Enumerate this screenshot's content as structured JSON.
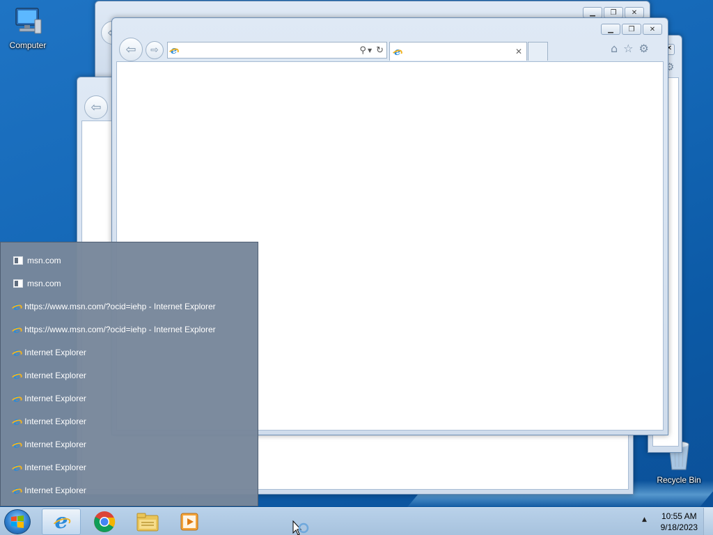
{
  "desktop": {
    "icons": [
      {
        "label": "Computer",
        "icon": "computer-icon"
      },
      {
        "label": "Recycle Bin",
        "icon": "recycle-bin-icon"
      }
    ]
  },
  "jumplist": {
    "items": [
      {
        "label": "msn.com",
        "icon": "page-icon"
      },
      {
        "label": "msn.com",
        "icon": "page-icon"
      },
      {
        "label": "https://www.msn.com/?ocid=iehp - Internet Explorer",
        "icon": "ie-icon"
      },
      {
        "label": "https://www.msn.com/?ocid=iehp - Internet Explorer",
        "icon": "ie-icon"
      },
      {
        "label": "Internet Explorer",
        "icon": "ie-icon"
      },
      {
        "label": "Internet Explorer",
        "icon": "ie-icon"
      },
      {
        "label": "Internet Explorer",
        "icon": "ie-icon"
      },
      {
        "label": "Internet Explorer",
        "icon": "ie-icon"
      },
      {
        "label": "Internet Explorer",
        "icon": "ie-icon"
      },
      {
        "label": "Internet Explorer",
        "icon": "ie-icon"
      },
      {
        "label": "Internet Explorer",
        "icon": "ie-icon"
      }
    ]
  },
  "browser": {
    "address_value": "",
    "tab_title": ""
  },
  "taskbar": {
    "pinned": [
      "internet-explorer",
      "google-chrome",
      "file-explorer",
      "media-player"
    ],
    "time": "10:55 AM",
    "date": "9/18/2023"
  },
  "colors": {
    "desktop": "#1467b6",
    "jumplist_bg": "#78879b",
    "taskbar": "#c8dcf0"
  }
}
